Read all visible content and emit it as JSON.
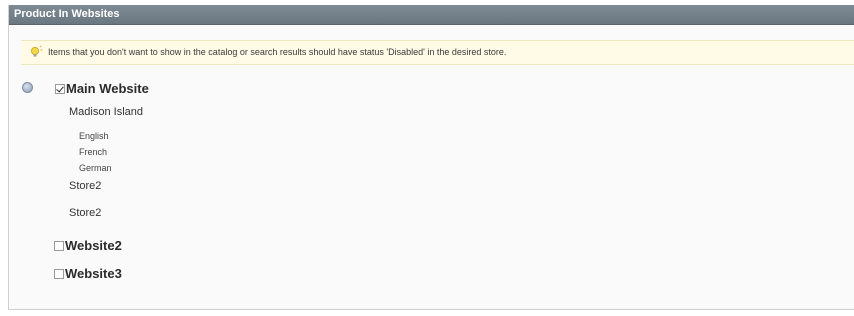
{
  "panel": {
    "title": "Product In Websites"
  },
  "notice": {
    "icon": "lightbulb-icon",
    "text": "Items that you don't want to show in the catalog or search results should have status 'Disabled' in the desired store."
  },
  "help_icon": "help-icon",
  "websites": [
    {
      "name": "Main Website",
      "checked": true,
      "groups": [
        {
          "name": "Madison Island",
          "store_views": [
            "English",
            "French",
            "German"
          ]
        },
        {
          "name": "Store2",
          "store_views": []
        },
        {
          "name": "Store2",
          "store_views": []
        }
      ]
    },
    {
      "name": "Website2",
      "checked": false,
      "groups": []
    },
    {
      "name": "Website3",
      "checked": false,
      "groups": []
    }
  ],
  "colors": {
    "header_bg": "#6b7780",
    "notice_bg": "#fffbe6"
  }
}
